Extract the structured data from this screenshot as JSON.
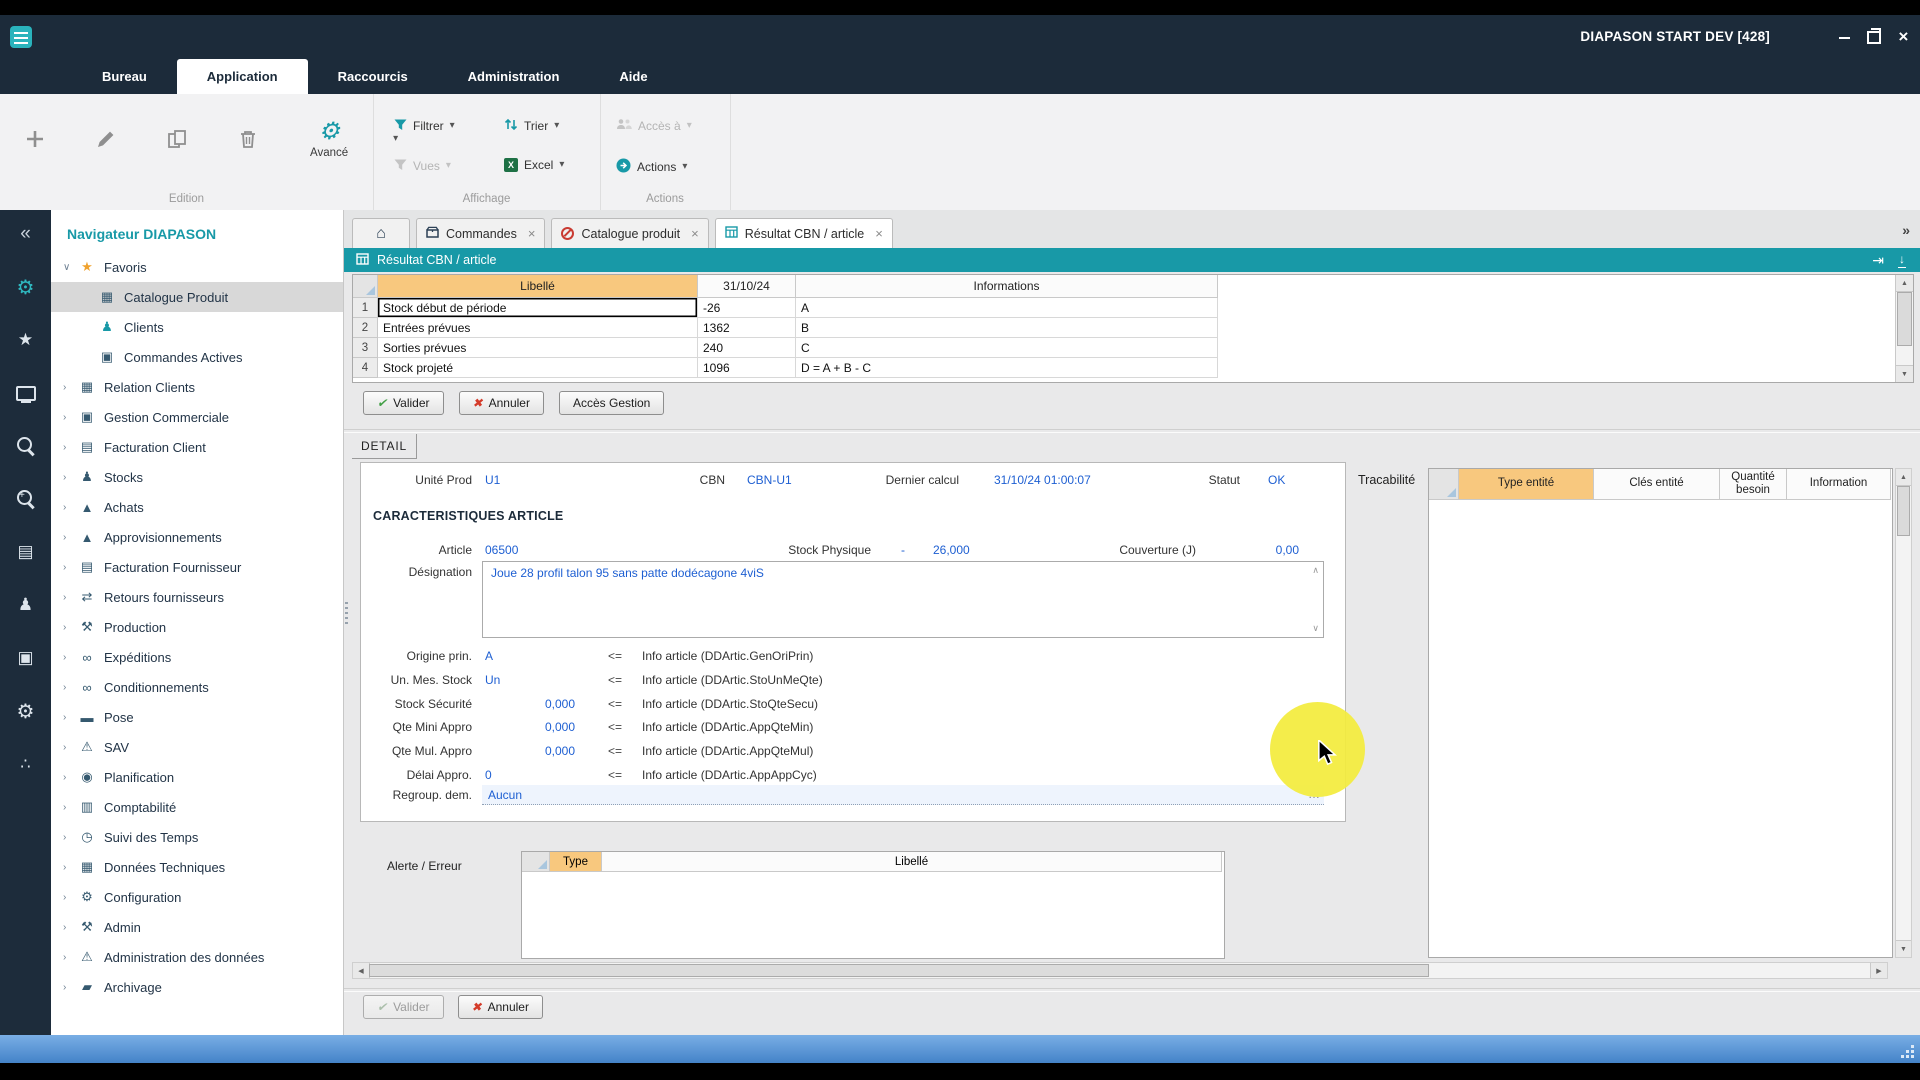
{
  "colors": {
    "teal": "#1899A7",
    "navy": "#1C2B3A",
    "grid_header_orange": "#F8C87E",
    "value_blue": "#1E5FD2",
    "highlight_yellow": "#F3EB3C"
  },
  "titlebar": {
    "title": "DIAPASON START DEV [428]"
  },
  "menubar": {
    "items": [
      {
        "label": "Bureau"
      },
      {
        "label": "Application"
      },
      {
        "label": "Raccourcis"
      },
      {
        "label": "Administration"
      },
      {
        "label": "Aide"
      }
    ]
  },
  "ribbon": {
    "avance": "Avancé",
    "filtrer": "Filtrer",
    "trier": "Trier",
    "vues": "Vues",
    "excel": "Excel",
    "acces_a": "Accès à",
    "actions": "Actions",
    "groups": {
      "edition": "Edition",
      "affichage": "Affichage",
      "actions": "Actions"
    }
  },
  "sidebar_icons": [
    "collapse-icon",
    "modules-gear-icon",
    "favorites-star-icon",
    "desktop-icon",
    "search-icon",
    "search-plus-icon",
    "documents-icon",
    "user-security-icon",
    "package-icon",
    "settings-gear-icon",
    "sitemap-icon"
  ],
  "nav": {
    "title": "Navigateur DIAPASON",
    "items": [
      {
        "label": "Favoris",
        "icon": "star-icon",
        "glyph": "★",
        "chev": "∨",
        "cls": "root fav"
      },
      {
        "label": "Catalogue Produit",
        "icon": "catalog-icon",
        "glyph": "▦",
        "chev": "",
        "cls": "child selected"
      },
      {
        "label": "Clients",
        "icon": "clients-icon",
        "glyph": "♟",
        "chev": "",
        "cls": "child teal"
      },
      {
        "label": "Commandes Actives",
        "icon": "orders-icon",
        "glyph": "▣",
        "chev": "",
        "cls": "child"
      },
      {
        "label": "Relation Clients",
        "icon": "calendar-icon",
        "glyph": "▦",
        "chev": "›",
        "cls": "root"
      },
      {
        "label": "Gestion Commerciale",
        "icon": "commerce-icon",
        "glyph": "▣",
        "chev": "›",
        "cls": "root"
      },
      {
        "label": "Facturation Client",
        "icon": "invoice-icon",
        "glyph": "▤",
        "chev": "›",
        "cls": "root"
      },
      {
        "label": "Stocks",
        "icon": "stocks-icon",
        "glyph": "♟",
        "chev": "›",
        "cls": "root"
      },
      {
        "label": "Achats",
        "icon": "purchases-icon",
        "glyph": "▲",
        "chev": "›",
        "cls": "root"
      },
      {
        "label": "Approvisionnements",
        "icon": "supply-icon",
        "glyph": "▲",
        "chev": "›",
        "cls": "root"
      },
      {
        "label": "Facturation Fournisseur",
        "icon": "supplier-invoice-icon",
        "glyph": "▤",
        "chev": "›",
        "cls": "root"
      },
      {
        "label": "Retours fournisseurs",
        "icon": "returns-icon",
        "glyph": "⇄",
        "chev": "›",
        "cls": "root"
      },
      {
        "label": "Production",
        "icon": "production-icon",
        "glyph": "⚒",
        "chev": "›",
        "cls": "root"
      },
      {
        "label": "Expéditions",
        "icon": "shipping-icon",
        "glyph": "∞",
        "chev": "›",
        "cls": "root"
      },
      {
        "label": "Conditionnements",
        "icon": "packaging-icon",
        "glyph": "∞",
        "chev": "›",
        "cls": "root"
      },
      {
        "label": "Pose",
        "icon": "install-icon",
        "glyph": "▬",
        "chev": "›",
        "cls": "root"
      },
      {
        "label": "SAV",
        "icon": "warning-icon",
        "glyph": "⚠",
        "chev": "›",
        "cls": "root"
      },
      {
        "label": "Planification",
        "icon": "planning-icon",
        "glyph": "◉",
        "chev": "›",
        "cls": "root"
      },
      {
        "label": "Comptabilité",
        "icon": "accounting-icon",
        "glyph": "▥",
        "chev": "›",
        "cls": "root"
      },
      {
        "label": "Suivi des Temps",
        "icon": "time-icon",
        "glyph": "◷",
        "chev": "›",
        "cls": "root"
      },
      {
        "label": "Données Techniques",
        "icon": "tech-data-icon",
        "glyph": "▦",
        "chev": "›",
        "cls": "root"
      },
      {
        "label": "Configuration",
        "icon": "gear-icon",
        "glyph": "⚙",
        "chev": "›",
        "cls": "root"
      },
      {
        "label": "Admin",
        "icon": "wrench-icon",
        "glyph": "⚒",
        "chev": "›",
        "cls": "root"
      },
      {
        "label": "Administration des données",
        "icon": "warning-icon",
        "glyph": "⚠",
        "chev": "›",
        "cls": "root"
      },
      {
        "label": "Archivage",
        "icon": "archive-icon",
        "glyph": "▰",
        "chev": "›",
        "cls": "root"
      }
    ]
  },
  "tabs": {
    "items": [
      {
        "label": "Commandes"
      },
      {
        "label": "Catalogue produit"
      },
      {
        "label": "Résultat CBN / article"
      }
    ]
  },
  "panel_header": {
    "title": "Résultat CBN / article"
  },
  "result_grid": {
    "columns": [
      "Libellé",
      "31/10/24",
      "Informations"
    ],
    "rows": [
      {
        "num": "1",
        "libelle": "Stock début de période",
        "value": "-26",
        "info": "A",
        "cls": "sel"
      },
      {
        "num": "2",
        "libelle": "Entrées prévues",
        "value": "1362",
        "info": "B"
      },
      {
        "num": "3",
        "libelle": "Sorties prévues",
        "value": "240",
        "info": "C"
      },
      {
        "num": "4",
        "libelle": "Stock projeté",
        "value": "1096",
        "info": "D = A + B - C"
      }
    ]
  },
  "buttons": {
    "valider": "Valider",
    "annuler": "Annuler",
    "acces_gestion": "Accès Gestion"
  },
  "detail": {
    "tab": "DETAIL",
    "unite_prod_label": "Unité Prod",
    "unite_prod": "U1",
    "cbn_label": "CBN",
    "cbn": "CBN-U1",
    "dernier_calcul_label": "Dernier calcul",
    "dernier_calcul": "31/10/24 01:00:07",
    "statut_label": "Statut",
    "statut": "OK",
    "section_title": "CARACTERISTIQUES ARTICLE",
    "article_label": "Article",
    "article": "06500",
    "stock_physique_label": "Stock Physique",
    "stock_physique_sign": "-",
    "stock_physique": "26,000",
    "couverture_label": "Couverture (J)",
    "couverture": "0,00",
    "designation_label": "Désignation",
    "designation": "Joue 28 profil talon 95 sans patte dodécagone 4viS",
    "mappings": [
      {
        "label": "Origine prin.",
        "value": "A",
        "arrow": "<=",
        "info": "Info article (DDArtic.GenOriPrin)"
      },
      {
        "label": "Un. Mes. Stock",
        "value": "Un",
        "arrow": "<=",
        "info": "Info article (DDArtic.StoUnMeQte)"
      },
      {
        "label": "Stock Sécurité",
        "value": "0,000",
        "arrow": "<=",
        "info": "Info article (DDArtic.StoQteSecu)",
        "cls": "numv"
      },
      {
        "label": "Qte Mini Appro",
        "value": "0,000",
        "arrow": "<=",
        "info": "Info article (DDArtic.AppQteMin)",
        "cls": "numv"
      },
      {
        "label": "Qte Mul. Appro",
        "value": "0,000",
        "arrow": "<=",
        "info": "Info article (DDArtic.AppQteMul)",
        "cls": "numv"
      },
      {
        "label": "Délai Appro.",
        "value": "0",
        "arrow": "<=",
        "info": "Info article (DDArtic.AppAppCyc)"
      }
    ],
    "regroup_label": "Regroup. dem.",
    "regroup": "Aucun"
  },
  "tracabilite": {
    "label": "Tracabilité",
    "columns": [
      "Type entité",
      "Clés entité",
      "Quantité besoin",
      "Information"
    ]
  },
  "alerte": {
    "label": "Alerte / Erreur",
    "columns": [
      "Type",
      "Libellé"
    ]
  },
  "bottom_buttons": {
    "valider": "Valider",
    "annuler": "Annuler"
  }
}
